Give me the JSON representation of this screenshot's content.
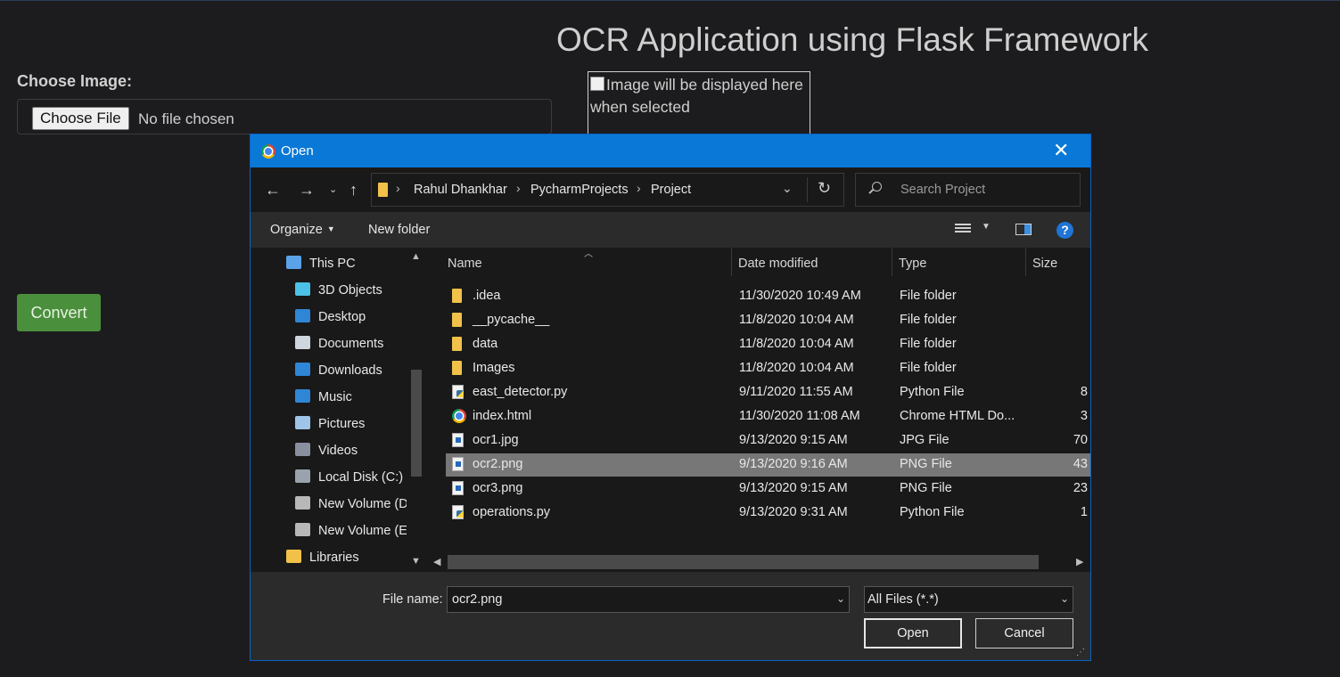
{
  "page": {
    "title": "OCR Application using Flask Framework",
    "choose_label": "Choose Image:",
    "choose_button": "Choose File",
    "no_file": "No file chosen",
    "convert_button": "Convert",
    "image_alt": "Image will be displayed here when selected"
  },
  "dialog": {
    "title": "Open",
    "breadcrumbs": [
      "Rahul Dhankhar",
      "PycharmProjects",
      "Project"
    ],
    "search_placeholder": "Search Project",
    "toolbar": {
      "organize": "Organize",
      "new_folder": "New folder"
    },
    "nav_items": [
      {
        "label": "This PC",
        "icon": "this-pc-icon",
        "color": "#5aa3e8"
      },
      {
        "label": "3D Objects",
        "icon": "3d-objects-icon",
        "color": "#4cc2e8"
      },
      {
        "label": "Desktop",
        "icon": "desktop-icon",
        "color": "#2f86d6"
      },
      {
        "label": "Documents",
        "icon": "documents-icon",
        "color": "#cfd6de"
      },
      {
        "label": "Downloads",
        "icon": "downloads-icon",
        "color": "#2f86d6"
      },
      {
        "label": "Music",
        "icon": "music-icon",
        "color": "#2f86d6"
      },
      {
        "label": "Pictures",
        "icon": "pictures-icon",
        "color": "#9fc6e8"
      },
      {
        "label": "Videos",
        "icon": "videos-icon",
        "color": "#8a8fa0"
      },
      {
        "label": "Local Disk (C:)",
        "icon": "local-disk-icon",
        "color": "#9aa3ad"
      },
      {
        "label": "New Volume (D",
        "icon": "drive-icon",
        "color": "#b8b8b8"
      },
      {
        "label": "New Volume (E",
        "icon": "drive-icon",
        "color": "#b8b8b8"
      },
      {
        "label": "Libraries",
        "icon": "libraries-icon",
        "color": "#f1c14a"
      }
    ],
    "columns": [
      "Name",
      "Date modified",
      "Type",
      "Size"
    ],
    "files": [
      {
        "name": ".idea",
        "date": "11/30/2020 10:49 AM",
        "type": "File folder",
        "size": "",
        "icon": "folder"
      },
      {
        "name": "__pycache__",
        "date": "11/8/2020 10:04 AM",
        "type": "File folder",
        "size": "",
        "icon": "folder"
      },
      {
        "name": "data",
        "date": "11/8/2020 10:04 AM",
        "type": "File folder",
        "size": "",
        "icon": "folder"
      },
      {
        "name": "Images",
        "date": "11/8/2020 10:04 AM",
        "type": "File folder",
        "size": "",
        "icon": "folder"
      },
      {
        "name": "east_detector.py",
        "date": "9/11/2020 11:55 AM",
        "type": "Python File",
        "size": "8",
        "icon": "py"
      },
      {
        "name": "index.html",
        "date": "11/30/2020 11:08 AM",
        "type": "Chrome HTML Do...",
        "size": "3",
        "icon": "chrome"
      },
      {
        "name": "ocr1.jpg",
        "date": "9/13/2020 9:15 AM",
        "type": "JPG File",
        "size": "70",
        "icon": "img"
      },
      {
        "name": "ocr2.png",
        "date": "9/13/2020 9:16 AM",
        "type": "PNG File",
        "size": "43",
        "icon": "img",
        "selected": true
      },
      {
        "name": "ocr3.png",
        "date": "9/13/2020 9:15 AM",
        "type": "PNG File",
        "size": "23",
        "icon": "img"
      },
      {
        "name": "operations.py",
        "date": "9/13/2020 9:31 AM",
        "type": "Python File",
        "size": "1",
        "icon": "py"
      }
    ],
    "file_name_label": "File name:",
    "file_name_value": "ocr2.png",
    "filter": "All Files (*.*)",
    "open_button": "Open",
    "cancel_button": "Cancel"
  }
}
